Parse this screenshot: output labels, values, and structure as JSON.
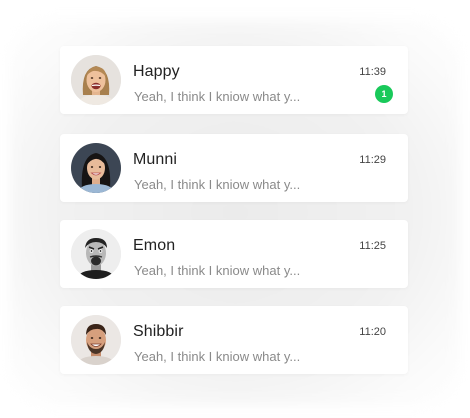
{
  "badge_color": "#19c95a",
  "chats": [
    {
      "name": "Happy",
      "preview": "Yeah, I think I kniow what y...",
      "time": "11:39",
      "unread": "1",
      "avatar_icon": "woman-laughing-avatar"
    },
    {
      "name": "Munni",
      "preview": "Yeah, I think I kniow what y...",
      "time": "11:29",
      "avatar_icon": "woman-smiling-avatar"
    },
    {
      "name": "Emon",
      "preview": "Yeah, I think I kniow what y...",
      "time": "11:25",
      "avatar_icon": "man-shouting-avatar"
    },
    {
      "name": "Shibbir",
      "preview": "Yeah, I think I kniow what y...",
      "time": "11:20",
      "avatar_icon": "man-laughing-avatar"
    }
  ]
}
